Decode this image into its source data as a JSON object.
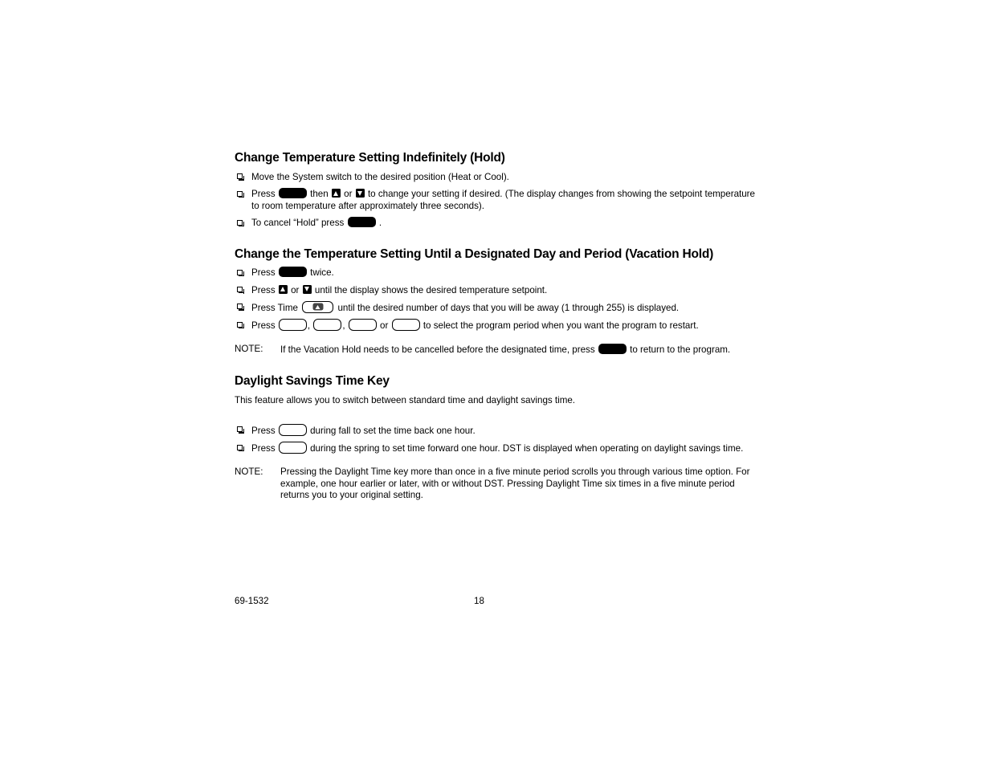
{
  "document": {
    "footer": {
      "document_number": "69-1532",
      "page_number": "18"
    }
  },
  "sections": [
    {
      "heading": "Change Temperature Setting Indefinitely (Hold)",
      "items": [
        {
          "text_before": "Move the System switch to the desired position (Heat or Cool)."
        },
        {
          "text_before": "Press",
          "key": "hold-key",
          "text_middle": "then",
          "arrow_up": "up-arrow-key",
          "text_or": "or",
          "arrow_down": "down-arrow-key",
          "text_after": "to change your setting if desired. (The display changes from showing the setpoint temperature to room temperature after approximately three seconds)."
        },
        {
          "text_before": "To cancel “Hold” press",
          "key": "hold-key",
          "text_after": "."
        }
      ]
    },
    {
      "heading": "Change the Temperature Setting Until a Designated Day and Period (Vacation Hold)",
      "items": [
        {
          "text_before": "Press",
          "key": "hold-key",
          "text_after": "twice."
        },
        {
          "text_before": "Press",
          "arrow_up": "up-arrow-key",
          "text_or": "or",
          "arrow_down": "down-arrow-key",
          "text_after": "until the display shows the desired temperature setpoint."
        },
        {
          "text_before": "Press Time",
          "key": "time-key",
          "text_after": "until the desired number of days that you will be away (1 through 255) is displayed."
        },
        {
          "text_before": "Press",
          "sep1": ",",
          "sep2": ",",
          "text_or": "or",
          "text_after": "to select the program period when you want the program to restart."
        }
      ],
      "note": {
        "label": "NOTE:",
        "text_before": "If the Vacation Hold needs to be cancelled before the designated time, press",
        "key": "hold-key",
        "text_after": "to return to the program."
      }
    },
    {
      "heading": "Daylight Savings Time Key",
      "intro": "This feature allows you to switch between standard time and daylight savings time.",
      "items": [
        {
          "text_before": "Press",
          "key": "daylight-key",
          "text_after": "during fall to set the time back one hour."
        },
        {
          "text_before": "Press",
          "key": "daylight-key",
          "text_after": "during the spring to set time forward one hour. DST is displayed when operating on daylight savings time."
        }
      ],
      "note": {
        "label": "NOTE:",
        "text": "Pressing the Daylight Time key more than once in a five minute period scrolls you through various time option. For example, one hour earlier or later, with or without DST. Pressing Daylight Time six times in a five minute period returns you to your original setting."
      }
    }
  ]
}
